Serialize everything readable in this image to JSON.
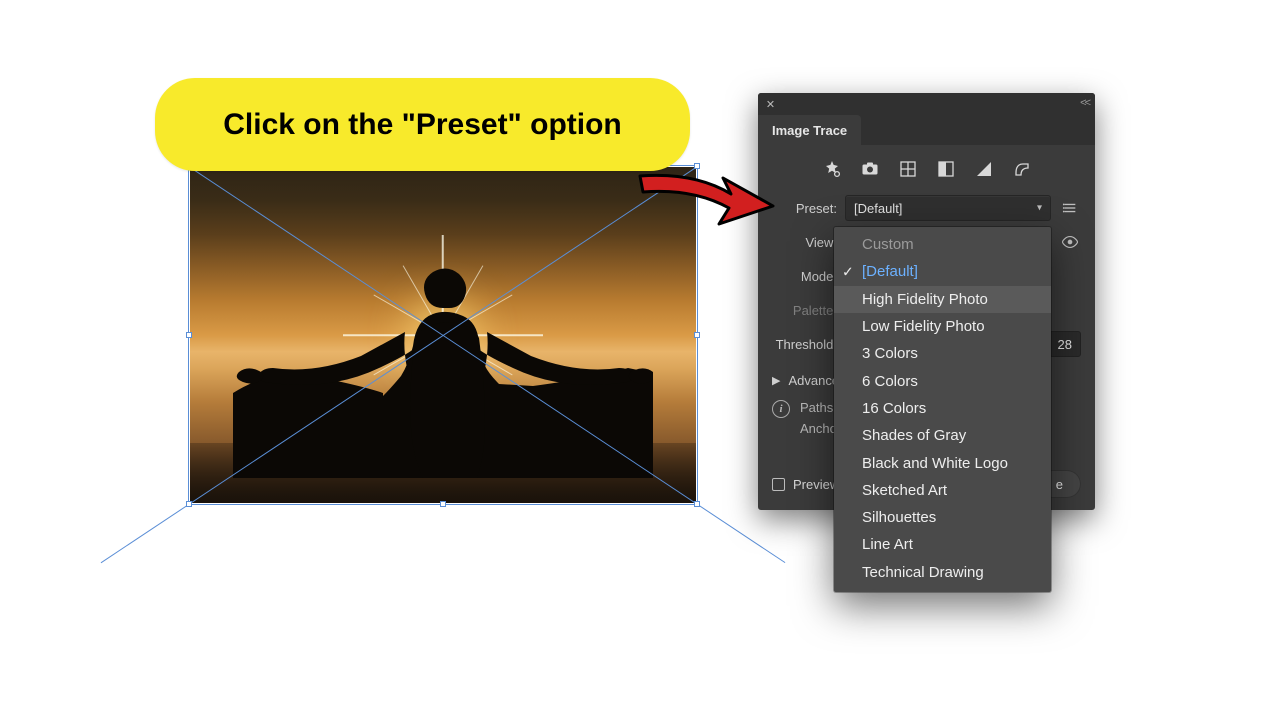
{
  "callout": {
    "text": "Click on the \"Preset\" option"
  },
  "panel": {
    "title": "Image Trace",
    "labels": {
      "preset": "Preset:",
      "view": "View:",
      "mode": "Mode:",
      "palette": "Palette:",
      "threshold": "Threshold:"
    },
    "preset_selected": "[Default]",
    "threshold_value": "28",
    "advanced_label": "Advanced",
    "info": {
      "paths": "Paths:",
      "anchors": "Anchors:"
    },
    "footer": {
      "preview_label": "Preview",
      "trace_label": "Trace"
    }
  },
  "dropdown": {
    "items": [
      {
        "label": "Custom",
        "state": "disabled"
      },
      {
        "label": "[Default]",
        "state": "selected"
      },
      {
        "label": "High Fidelity Photo",
        "state": "hover"
      },
      {
        "label": "Low Fidelity Photo",
        "state": ""
      },
      {
        "label": "3 Colors",
        "state": ""
      },
      {
        "label": "6 Colors",
        "state": ""
      },
      {
        "label": "16 Colors",
        "state": ""
      },
      {
        "label": "Shades of Gray",
        "state": ""
      },
      {
        "label": "Black and White Logo",
        "state": ""
      },
      {
        "label": "Sketched Art",
        "state": ""
      },
      {
        "label": "Silhouettes",
        "state": ""
      },
      {
        "label": "Line Art",
        "state": ""
      },
      {
        "label": "Technical Drawing",
        "state": ""
      }
    ]
  }
}
